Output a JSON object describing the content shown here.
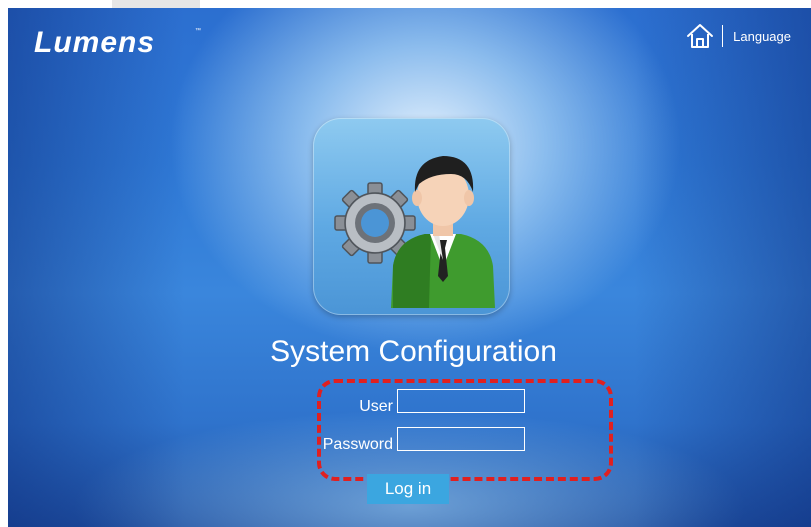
{
  "header": {
    "logo_text": "Lumens",
    "logo_tm": "™",
    "home_icon": "home-icon",
    "language_label": "Language"
  },
  "main": {
    "app_icon": "settings-user-icon",
    "title": "System Configuration",
    "fields": [
      {
        "label": "User",
        "value": "",
        "placeholder": ""
      },
      {
        "label": "Password",
        "value": "",
        "placeholder": ""
      }
    ],
    "login_label": "Log in"
  },
  "colors": {
    "background_blue": "#2f79d6",
    "highlight_red": "#e02020",
    "button_blue": "#3ba6e0",
    "text": "#ffffff"
  }
}
